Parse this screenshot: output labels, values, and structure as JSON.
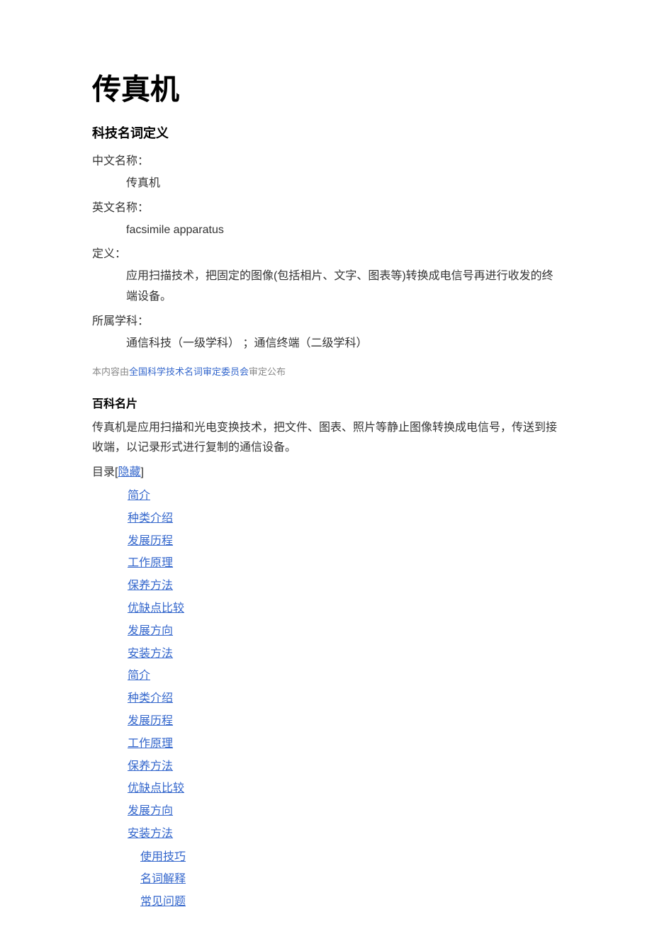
{
  "title": "传真机",
  "termDefinition": {
    "heading": "科技名词定义",
    "fields": {
      "chineseNameLabel": "中文名称：",
      "chineseNameValue": "传真机",
      "englishNameLabel": "英文名称：",
      "englishNameValue": "facsimile apparatus",
      "definitionLabel": "定义：",
      "definitionValue": "应用扫描技术，把固定的图像(包括相片、文字、图表等)转换成电信号再进行收发的终端设备。",
      "disciplineLabel": "所属学科：",
      "disciplineValue": "通信科技（一级学科） ；通信终端（二级学科）"
    }
  },
  "attribution": {
    "prefix": "本内容由",
    "linkText": "全国科学技术名词审定委员会",
    "suffix": "审定公布"
  },
  "card": {
    "heading": "百科名片",
    "description": "传真机是应用扫描和光电变换技术，把文件、图表、照片等静止图像转换成电信号，传送到接收端，以记录形式进行复制的通信设备。"
  },
  "toc": {
    "label": "目录",
    "hideLabel": "隐藏",
    "items1": [
      "简介",
      "种类介绍",
      "发展历程",
      "工作原理",
      "保养方法",
      "优缺点比较",
      "发展方向",
      "安装方法",
      "简介",
      "种类介绍",
      "发展历程",
      "工作原理",
      "保养方法",
      "优缺点比较",
      "发展方向",
      "安装方法"
    ],
    "items2": [
      "使用技巧",
      "名词解释",
      "常见问题"
    ]
  }
}
